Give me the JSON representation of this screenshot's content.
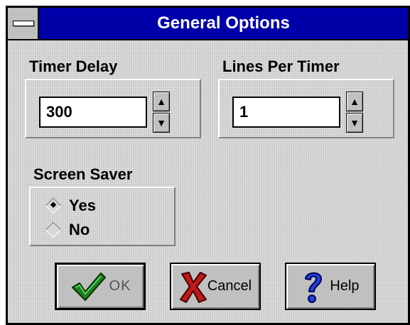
{
  "window": {
    "title": "General Options"
  },
  "timer_delay": {
    "label": "Timer Delay",
    "value": "300"
  },
  "lines_per_timer": {
    "label": "Lines Per Timer",
    "value": "1"
  },
  "spinner": {
    "up_glyph": "▲",
    "down_glyph": "▼"
  },
  "screen_saver": {
    "label": "Screen Saver",
    "options": [
      {
        "label": "Yes",
        "selected": true
      },
      {
        "label": "No",
        "selected": false
      }
    ]
  },
  "buttons": {
    "ok": "OK",
    "cancel": "Cancel",
    "help": "Help"
  },
  "icons": {
    "ok": "green-checkmark-icon",
    "cancel": "red-x-icon",
    "help": "blue-question-mark-icon",
    "system_menu": "system-menu-icon"
  }
}
